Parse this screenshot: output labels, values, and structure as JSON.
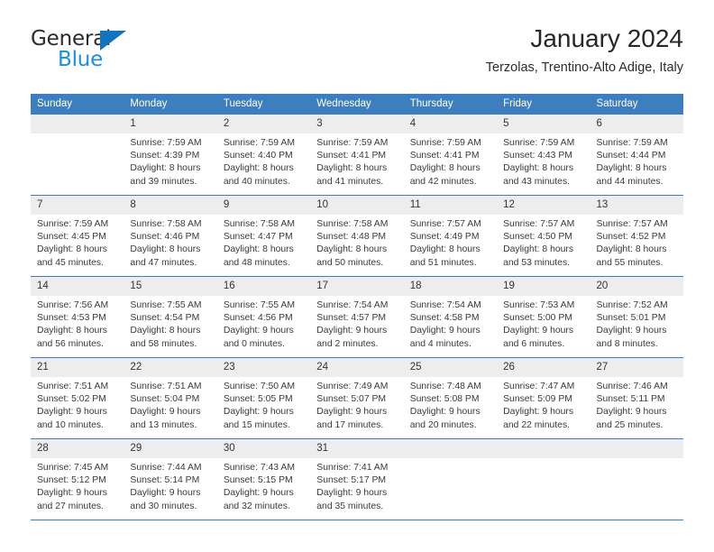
{
  "brand": {
    "name_top": "General",
    "name_bottom": "Blue",
    "accent_color": "#1274bc",
    "accent_color_light": "#1a8fe0"
  },
  "header": {
    "title": "January 2024",
    "subtitle": "Terzolas, Trentino-Alto Adige, Italy"
  },
  "theme": {
    "header_blue": "#3d7ebf",
    "daynum_band": "#ededed",
    "text": "#333333"
  },
  "calendar": {
    "weekday_headers": [
      "Sunday",
      "Monday",
      "Tuesday",
      "Wednesday",
      "Thursday",
      "Friday",
      "Saturday"
    ],
    "weeks": [
      [
        {
          "day": "",
          "blank": true,
          "sunrise": "",
          "sunset": "",
          "daylight_1": "",
          "daylight_2": ""
        },
        {
          "day": "1",
          "sunrise": "Sunrise: 7:59 AM",
          "sunset": "Sunset: 4:39 PM",
          "daylight_1": "Daylight: 8 hours",
          "daylight_2": "and 39 minutes."
        },
        {
          "day": "2",
          "sunrise": "Sunrise: 7:59 AM",
          "sunset": "Sunset: 4:40 PM",
          "daylight_1": "Daylight: 8 hours",
          "daylight_2": "and 40 minutes."
        },
        {
          "day": "3",
          "sunrise": "Sunrise: 7:59 AM",
          "sunset": "Sunset: 4:41 PM",
          "daylight_1": "Daylight: 8 hours",
          "daylight_2": "and 41 minutes."
        },
        {
          "day": "4",
          "sunrise": "Sunrise: 7:59 AM",
          "sunset": "Sunset: 4:41 PM",
          "daylight_1": "Daylight: 8 hours",
          "daylight_2": "and 42 minutes."
        },
        {
          "day": "5",
          "sunrise": "Sunrise: 7:59 AM",
          "sunset": "Sunset: 4:43 PM",
          "daylight_1": "Daylight: 8 hours",
          "daylight_2": "and 43 minutes."
        },
        {
          "day": "6",
          "sunrise": "Sunrise: 7:59 AM",
          "sunset": "Sunset: 4:44 PM",
          "daylight_1": "Daylight: 8 hours",
          "daylight_2": "and 44 minutes."
        }
      ],
      [
        {
          "day": "7",
          "sunrise": "Sunrise: 7:59 AM",
          "sunset": "Sunset: 4:45 PM",
          "daylight_1": "Daylight: 8 hours",
          "daylight_2": "and 45 minutes."
        },
        {
          "day": "8",
          "sunrise": "Sunrise: 7:58 AM",
          "sunset": "Sunset: 4:46 PM",
          "daylight_1": "Daylight: 8 hours",
          "daylight_2": "and 47 minutes."
        },
        {
          "day": "9",
          "sunrise": "Sunrise: 7:58 AM",
          "sunset": "Sunset: 4:47 PM",
          "daylight_1": "Daylight: 8 hours",
          "daylight_2": "and 48 minutes."
        },
        {
          "day": "10",
          "sunrise": "Sunrise: 7:58 AM",
          "sunset": "Sunset: 4:48 PM",
          "daylight_1": "Daylight: 8 hours",
          "daylight_2": "and 50 minutes."
        },
        {
          "day": "11",
          "sunrise": "Sunrise: 7:57 AM",
          "sunset": "Sunset: 4:49 PM",
          "daylight_1": "Daylight: 8 hours",
          "daylight_2": "and 51 minutes."
        },
        {
          "day": "12",
          "sunrise": "Sunrise: 7:57 AM",
          "sunset": "Sunset: 4:50 PM",
          "daylight_1": "Daylight: 8 hours",
          "daylight_2": "and 53 minutes."
        },
        {
          "day": "13",
          "sunrise": "Sunrise: 7:57 AM",
          "sunset": "Sunset: 4:52 PM",
          "daylight_1": "Daylight: 8 hours",
          "daylight_2": "and 55 minutes."
        }
      ],
      [
        {
          "day": "14",
          "sunrise": "Sunrise: 7:56 AM",
          "sunset": "Sunset: 4:53 PM",
          "daylight_1": "Daylight: 8 hours",
          "daylight_2": "and 56 minutes."
        },
        {
          "day": "15",
          "sunrise": "Sunrise: 7:55 AM",
          "sunset": "Sunset: 4:54 PM",
          "daylight_1": "Daylight: 8 hours",
          "daylight_2": "and 58 minutes."
        },
        {
          "day": "16",
          "sunrise": "Sunrise: 7:55 AM",
          "sunset": "Sunset: 4:56 PM",
          "daylight_1": "Daylight: 9 hours",
          "daylight_2": "and 0 minutes."
        },
        {
          "day": "17",
          "sunrise": "Sunrise: 7:54 AM",
          "sunset": "Sunset: 4:57 PM",
          "daylight_1": "Daylight: 9 hours",
          "daylight_2": "and 2 minutes."
        },
        {
          "day": "18",
          "sunrise": "Sunrise: 7:54 AM",
          "sunset": "Sunset: 4:58 PM",
          "daylight_1": "Daylight: 9 hours",
          "daylight_2": "and 4 minutes."
        },
        {
          "day": "19",
          "sunrise": "Sunrise: 7:53 AM",
          "sunset": "Sunset: 5:00 PM",
          "daylight_1": "Daylight: 9 hours",
          "daylight_2": "and 6 minutes."
        },
        {
          "day": "20",
          "sunrise": "Sunrise: 7:52 AM",
          "sunset": "Sunset: 5:01 PM",
          "daylight_1": "Daylight: 9 hours",
          "daylight_2": "and 8 minutes."
        }
      ],
      [
        {
          "day": "21",
          "sunrise": "Sunrise: 7:51 AM",
          "sunset": "Sunset: 5:02 PM",
          "daylight_1": "Daylight: 9 hours",
          "daylight_2": "and 10 minutes."
        },
        {
          "day": "22",
          "sunrise": "Sunrise: 7:51 AM",
          "sunset": "Sunset: 5:04 PM",
          "daylight_1": "Daylight: 9 hours",
          "daylight_2": "and 13 minutes."
        },
        {
          "day": "23",
          "sunrise": "Sunrise: 7:50 AM",
          "sunset": "Sunset: 5:05 PM",
          "daylight_1": "Daylight: 9 hours",
          "daylight_2": "and 15 minutes."
        },
        {
          "day": "24",
          "sunrise": "Sunrise: 7:49 AM",
          "sunset": "Sunset: 5:07 PM",
          "daylight_1": "Daylight: 9 hours",
          "daylight_2": "and 17 minutes."
        },
        {
          "day": "25",
          "sunrise": "Sunrise: 7:48 AM",
          "sunset": "Sunset: 5:08 PM",
          "daylight_1": "Daylight: 9 hours",
          "daylight_2": "and 20 minutes."
        },
        {
          "day": "26",
          "sunrise": "Sunrise: 7:47 AM",
          "sunset": "Sunset: 5:09 PM",
          "daylight_1": "Daylight: 9 hours",
          "daylight_2": "and 22 minutes."
        },
        {
          "day": "27",
          "sunrise": "Sunrise: 7:46 AM",
          "sunset": "Sunset: 5:11 PM",
          "daylight_1": "Daylight: 9 hours",
          "daylight_2": "and 25 minutes."
        }
      ],
      [
        {
          "day": "28",
          "sunrise": "Sunrise: 7:45 AM",
          "sunset": "Sunset: 5:12 PM",
          "daylight_1": "Daylight: 9 hours",
          "daylight_2": "and 27 minutes."
        },
        {
          "day": "29",
          "sunrise": "Sunrise: 7:44 AM",
          "sunset": "Sunset: 5:14 PM",
          "daylight_1": "Daylight: 9 hours",
          "daylight_2": "and 30 minutes."
        },
        {
          "day": "30",
          "sunrise": "Sunrise: 7:43 AM",
          "sunset": "Sunset: 5:15 PM",
          "daylight_1": "Daylight: 9 hours",
          "daylight_2": "and 32 minutes."
        },
        {
          "day": "31",
          "sunrise": "Sunrise: 7:41 AM",
          "sunset": "Sunset: 5:17 PM",
          "daylight_1": "Daylight: 9 hours",
          "daylight_2": "and 35 minutes."
        },
        {
          "day": "",
          "blank": true,
          "sunrise": "",
          "sunset": "",
          "daylight_1": "",
          "daylight_2": ""
        },
        {
          "day": "",
          "blank": true,
          "sunrise": "",
          "sunset": "",
          "daylight_1": "",
          "daylight_2": ""
        },
        {
          "day": "",
          "blank": true,
          "sunrise": "",
          "sunset": "",
          "daylight_1": "",
          "daylight_2": ""
        }
      ]
    ]
  }
}
